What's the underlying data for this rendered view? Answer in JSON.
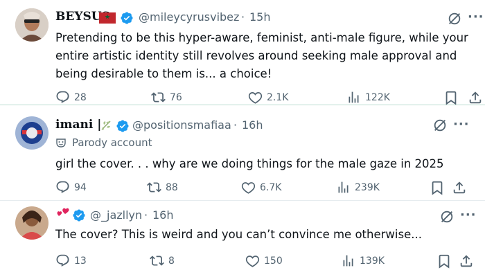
{
  "tweets": [
    {
      "name": "BEYSUS",
      "handle": "@mileycyrusvibez",
      "time": "15h",
      "text": "Pretending to be this hyper-aware, feminist, anti-male figure, while your entire artistic identity still revolves around seeking male approval and being desirable to them is... a choice!",
      "replies": "28",
      "reposts": "76",
      "likes": "2.1K",
      "views": "122K"
    },
    {
      "name": "imani |",
      "handle": "@positionsmafiaa",
      "time": "16h",
      "label": "Parody account",
      "text": "girl the cover. . . why are we doing things for the male gaze in 2025",
      "replies": "94",
      "reposts": "88",
      "likes": "6.7K",
      "views": "239K"
    },
    {
      "handle": "@_jazllyn",
      "time": "16h",
      "text": "The cover? This is weird and you can’t convince me otherwise...",
      "replies": "13",
      "reposts": "8",
      "likes": "150",
      "views": "139K"
    }
  ],
  "separator": "·",
  "more_glyph": "···",
  "colors": {
    "verified": "#1d9bf0",
    "muted": "#536471",
    "separator": "#b9ddd0"
  }
}
